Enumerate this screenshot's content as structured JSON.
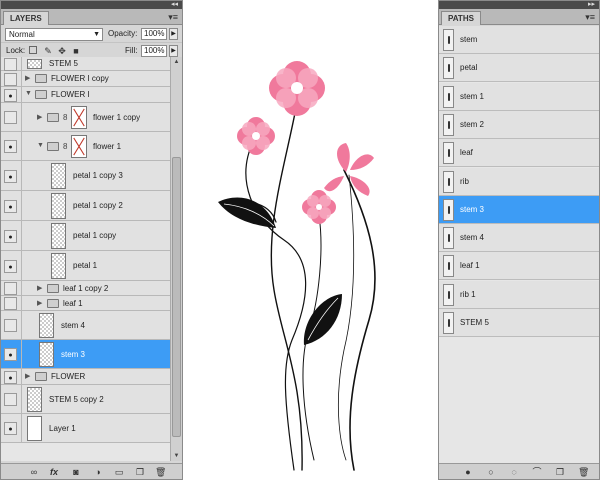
{
  "layers_panel": {
    "tab_label": "LAYERS",
    "blend_mode": "Normal",
    "opacity_label": "Opacity:",
    "opacity_value": "100%",
    "lock_label": "Lock:",
    "fill_label": "Fill:",
    "fill_value": "100%",
    "layers": [
      {
        "name": "STEM 5",
        "type": "layer",
        "visible": false,
        "indent": 0,
        "selected": false
      },
      {
        "name": "FLOWER I copy",
        "type": "group",
        "visible": false,
        "indent": 0,
        "expanded": false,
        "selected": false
      },
      {
        "name": "FLOWER I",
        "type": "group",
        "visible": true,
        "indent": 0,
        "expanded": true,
        "selected": false
      },
      {
        "name": "flower 1 copy",
        "type": "group-masked",
        "visible": false,
        "indent": 1,
        "expanded": false,
        "selected": false
      },
      {
        "name": "flower 1",
        "type": "group-masked",
        "visible": true,
        "indent": 1,
        "expanded": true,
        "selected": false
      },
      {
        "name": "petal 1 copy 3",
        "type": "layer",
        "visible": true,
        "indent": 2,
        "selected": false
      },
      {
        "name": "petal 1 copy 2",
        "type": "layer",
        "visible": true,
        "indent": 2,
        "selected": false
      },
      {
        "name": "petal 1 copy",
        "type": "layer",
        "visible": true,
        "indent": 2,
        "selected": false
      },
      {
        "name": "petal 1",
        "type": "layer",
        "visible": true,
        "indent": 2,
        "selected": false
      },
      {
        "name": "leaf 1 copy 2",
        "type": "group",
        "visible": false,
        "indent": 1,
        "expanded": false,
        "selected": false
      },
      {
        "name": "leaf 1",
        "type": "group",
        "visible": false,
        "indent": 1,
        "expanded": false,
        "selected": false
      },
      {
        "name": "stem 4",
        "type": "layer",
        "visible": false,
        "indent": 1,
        "selected": false
      },
      {
        "name": "stem 3",
        "type": "layer",
        "visible": true,
        "indent": 1,
        "selected": true
      },
      {
        "name": "FLOWER",
        "type": "group",
        "visible": true,
        "indent": 0,
        "expanded": false,
        "selected": false
      },
      {
        "name": "STEM 5 copy 2",
        "type": "layer",
        "visible": false,
        "indent": 0,
        "selected": false
      },
      {
        "name": "Layer 1",
        "type": "layer-white",
        "visible": true,
        "indent": 0,
        "selected": false
      }
    ]
  },
  "paths_panel": {
    "tab_label": "PATHS",
    "paths": [
      {
        "name": "stem",
        "selected": false
      },
      {
        "name": "petal",
        "selected": false
      },
      {
        "name": "stem 1",
        "selected": false
      },
      {
        "name": "stem 2",
        "selected": false
      },
      {
        "name": "leaf",
        "selected": false
      },
      {
        "name": "rib",
        "selected": false
      },
      {
        "name": "stem 3",
        "selected": true
      },
      {
        "name": "stem 4",
        "selected": false
      },
      {
        "name": "leaf 1",
        "selected": false
      },
      {
        "name": "rib 1",
        "selected": false
      },
      {
        "name": "STEM 5",
        "selected": false
      }
    ]
  },
  "canvas": {
    "petal_color": "#f0799c",
    "petal_light_color": "#f7a8c0",
    "center_color": "#ffffff",
    "ink_color": "#111111"
  },
  "icons": {
    "collapse": "double-chevron-icon",
    "panel_menu": "panel-menu-icon",
    "visibility": "eye-icon",
    "folder": "folder-icon",
    "link": "link-icon",
    "mask": "vector-mask-icon"
  }
}
